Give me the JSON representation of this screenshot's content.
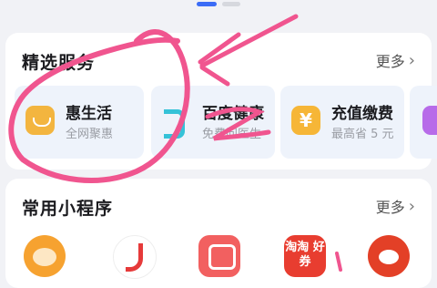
{
  "featured": {
    "title": "精选服务",
    "more": "更多",
    "services": [
      {
        "name": "惠生活",
        "desc": "全网聚惠",
        "icon": "hui-life-icon"
      },
      {
        "name": "百度健康",
        "desc": "免费问医生",
        "icon": "baidu-health-icon"
      },
      {
        "name": "充值缴费",
        "desc": "最高省 5 元",
        "icon": "recharge-icon"
      },
      {
        "name": "",
        "desc": "",
        "icon": "purple-service-icon"
      }
    ]
  },
  "mini_programs": {
    "title": "常用小程序",
    "more": "更多",
    "items": [
      {
        "icon": "tiger-avatar-icon"
      },
      {
        "icon": "red-d-logo-icon"
      },
      {
        "icon": "red-frame-logo-icon"
      },
      {
        "icon": "taotao-logo-icon",
        "text": "淘淘 好券"
      },
      {
        "icon": "red-owl-icon"
      }
    ]
  },
  "annotation": {
    "color": "#f0558f"
  }
}
